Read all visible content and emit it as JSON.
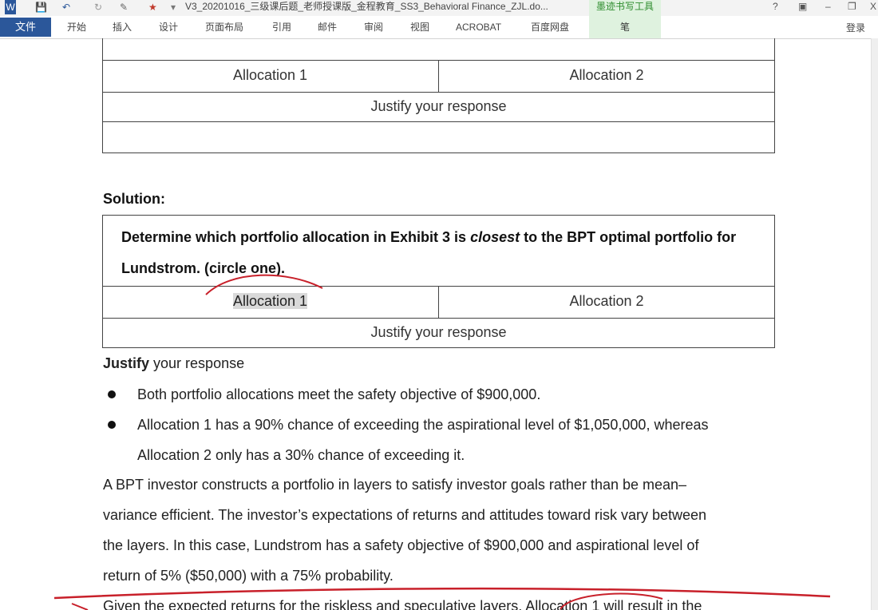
{
  "titlebar": {
    "doc_title": "V3_20201016_三级课后题_老师授课版_金程教育_SS3_Behavioral Finance_ZJL.do...",
    "ink_tool_label": "墨迹书写工具",
    "help": "?",
    "minimize": "–",
    "close": "X"
  },
  "ribbon": {
    "file_tab": "文件",
    "tabs": [
      "开始",
      "插入",
      "设计",
      "页面布局",
      "引用",
      "邮件",
      "审阅",
      "视图",
      "ACROBAT",
      "百度网盘"
    ],
    "pen_tab": "笔",
    "login": "登录"
  },
  "document": {
    "table1": {
      "alloc1": "Allocation 1",
      "alloc2": "Allocation 2",
      "justify": "Justify your response"
    },
    "solution_heading": "Solution:",
    "table2": {
      "question_part1": "Determine which portfolio allocation in Exhibit 3 is ",
      "question_italic": "closest",
      "question_part2": " to the BPT optimal portfolio for",
      "question_line2": "Lundstrom. (circle one).",
      "alloc1": "Allocation 1",
      "alloc2": "Allocation 2",
      "justify": "Justify your response"
    },
    "justify_bold": "Justify",
    "justify_rest": " your response",
    "bullets": [
      "Both portfolio allocations meet the safety objective of $900,000.",
      "Allocation 1 has a 90% chance of exceeding the aspirational level of $1,050,000, whereas",
      "Allocation 2 only has a 30% chance of exceeding it."
    ],
    "paragraph_lines": [
      "A BPT investor constructs a portfolio in layers to satisfy investor goals rather than be mean–",
      "variance efficient. The investor’s expectations of returns and attitudes toward risk vary between",
      "the layers. In this case, Lundstrom has a safety objective of $900,000 and aspirational level of",
      "return of 5% ($50,000) with a 75% probability."
    ],
    "last_line": "Given the expected returns for the riskless and speculative layers, Allocation 1 will result in the"
  },
  "colors": {
    "ribbon_blue": "#2b579a",
    "ink_red": "#c8202a",
    "ink_tool_green": "#dff2df"
  }
}
